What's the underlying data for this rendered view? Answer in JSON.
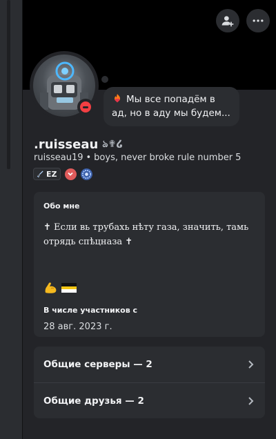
{
  "profile": {
    "display_name": ".ruisseau",
    "name_decoration": "ঌ✟໒",
    "username": "ruisseau19",
    "pronouns_separator": "•",
    "bio_short": "boys, never broke rule number 5",
    "status": "dnd",
    "status_color": "#f23f43",
    "guild_tag": "EZ",
    "custom_status": {
      "emoji": "fire-heart-icon",
      "text": "Мы все попадём в ад, но в аду мы будем..."
    }
  },
  "about": {
    "title": "Обо мне",
    "text": "✝ Если вь трубахь нѣту газа, значить, тамь отрядь спѣцназа ✝",
    "emojis": [
      "flexed-biceps-icon",
      "black-yellow-white-flag-icon"
    ]
  },
  "member_since": {
    "title": "В числе участников с",
    "date": "28 авг. 2023 г."
  },
  "links": [
    {
      "label": "Общие серверы — 2"
    },
    {
      "label": "Общие друзья — 2"
    }
  ],
  "colors": {
    "background": "#232428",
    "card": "#2b2d31",
    "text": "#f2f3f5",
    "dnd": "#f23f43"
  }
}
